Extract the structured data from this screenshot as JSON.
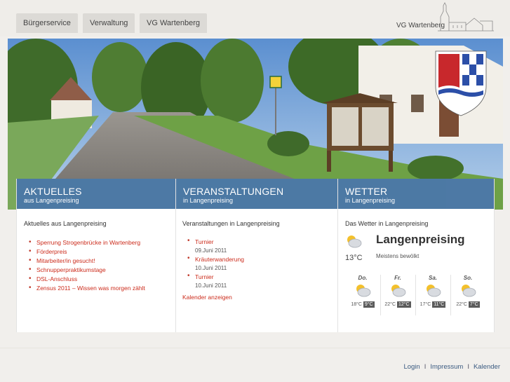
{
  "nav": {
    "tabs": [
      "Bürgerservice",
      "Verwaltung",
      "VG Wartenberg"
    ]
  },
  "brand": "VG Wartenberg",
  "panels": {
    "news": {
      "title": "AKTUELLES",
      "subtitle": "aus Langenpreising",
      "heading": "Aktuelles aus Langenpreising",
      "items": [
        "Sperrung Strogenbrücke in Wartenberg",
        "Förderpreis",
        "Mitarbeiter/in gesucht!",
        "Schnupperpraktikumstage",
        "DSL-Anschluss",
        "Zensus 2011 – Wissen was morgen zählt"
      ]
    },
    "events": {
      "title": "VERANSTALTUNGEN",
      "subtitle": "in Langenpreising",
      "heading": "Veranstaltungen in Langenpreising",
      "items": [
        {
          "name": "Turnier",
          "date": "09.Juni 2011"
        },
        {
          "name": "Kräuterwanderung",
          "date": "10.Juni 2011"
        },
        {
          "name": "Turnier",
          "date": "10.Juni 2011"
        }
      ],
      "calendar_link": "Kalender anzeigen"
    },
    "weather": {
      "title": "WETTER",
      "subtitle": "in Langenpreising",
      "heading": "Das Wetter in Langenpreising",
      "city": "Langenpreising",
      "current_temp": "13°C",
      "current_desc": "Meistens bewölkt",
      "forecast": [
        {
          "day": "Do.",
          "low": "18°C",
          "high": "9°C"
        },
        {
          "day": "Fr.",
          "low": "22°C",
          "high": "12°C"
        },
        {
          "day": "Sa.",
          "low": "17°C",
          "high": "11°C"
        },
        {
          "day": "So.",
          "low": "22°C",
          "high": "7°C"
        }
      ]
    }
  },
  "footer": {
    "links": [
      "Login",
      "Impressum",
      "Kalender"
    ]
  },
  "colors": {
    "panel_header": "#3f6f9e",
    "link_red": "#cc2c1c",
    "background": "#f1efec"
  }
}
